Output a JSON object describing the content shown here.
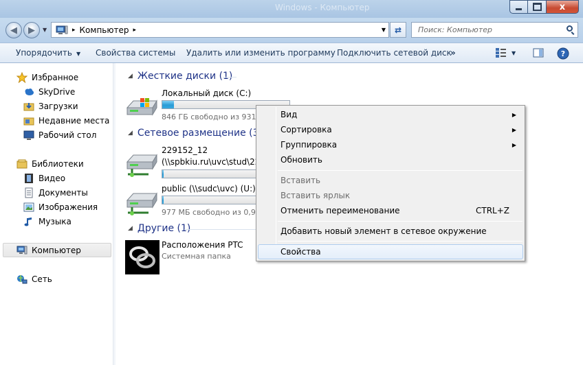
{
  "titlebar": {
    "ghost_title": "Windows - Компьютер",
    "close_glyph": "x"
  },
  "address": {
    "crumb": "Компьютер",
    "separator": "▸",
    "search_placeholder": "Поиск: Компьютер"
  },
  "commandbar": {
    "organize": "Упорядочить",
    "system_props": "Свойства системы",
    "uninstall": "Удалить или изменить программу",
    "map_drive": "Подключить сетевой диск",
    "more": "»"
  },
  "navpane": {
    "favorites": "Избранное",
    "skydrive": "SkyDrive",
    "downloads": "Загрузки",
    "recent": "Недавние места",
    "desktop": "Рабочий стол",
    "libraries": "Библиотеки",
    "video": "Видео",
    "documents": "Документы",
    "images": "Изображения",
    "music": "Музыка",
    "computer": "Компьютер",
    "network": "Сеть"
  },
  "content": {
    "groups": {
      "hdd": "Жесткие диски (1)",
      "network": "Сетевое размещение (3)",
      "other": "Другие (1)"
    },
    "local_disk": {
      "name": "Локальный диск (C:)",
      "free": "846 ГБ свободно из 931 Г",
      "used_fraction": 0.09
    },
    "share1": {
      "name": "229152_12",
      "path": "(\\\\spbkiu.ru\\uvc\\stud\\229",
      "used_fraction": 0.01
    },
    "share2": {
      "name": "public (\\\\sudc\\uvc) (U:)",
      "free": "977 МБ свободно из 0,97",
      "used_fraction": 0.01
    },
    "ptc": {
      "name": "Расположения PTC",
      "type": "Системная папка"
    }
  },
  "context_menu": {
    "view": "Вид",
    "sort": "Сортировка",
    "group": "Группировка",
    "refresh": "Обновить",
    "paste": "Вставить",
    "paste_shortcut": "Вставить ярлык",
    "undo_rename": "Отменить переименование",
    "undo_shortcut": "CTRL+Z",
    "add_network": "Добавить новый элемент в сетевое окружение",
    "properties": "Свойства",
    "submenu_arrow": "▶"
  },
  "colors": {
    "group_header": "#1e3287",
    "command_text": "#1e395b",
    "progress_fill": "#2a9cd6"
  }
}
